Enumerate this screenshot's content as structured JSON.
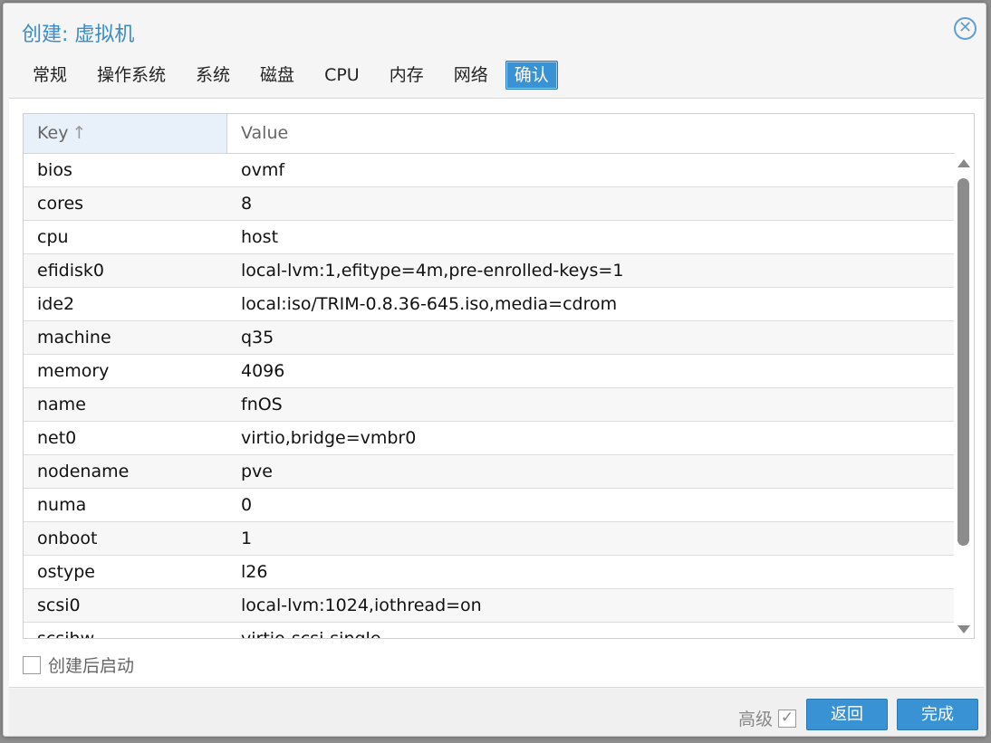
{
  "window": {
    "title": "创建: 虚拟机"
  },
  "tabs": [
    {
      "label": "常规"
    },
    {
      "label": "操作系统"
    },
    {
      "label": "系统"
    },
    {
      "label": "磁盘"
    },
    {
      "label": "CPU"
    },
    {
      "label": "内存"
    },
    {
      "label": "网络"
    },
    {
      "label": "确认",
      "active": true
    }
  ],
  "grid": {
    "columns": {
      "key": "Key",
      "value": "Value"
    },
    "sort_indicator": "↑",
    "rows": [
      {
        "key": "bios",
        "value": "ovmf"
      },
      {
        "key": "cores",
        "value": "8"
      },
      {
        "key": "cpu",
        "value": "host"
      },
      {
        "key": "efidisk0",
        "value": "local-lvm:1,efitype=4m,pre-enrolled-keys=1"
      },
      {
        "key": "ide2",
        "value": "local:iso/TRIM-0.8.36-645.iso,media=cdrom"
      },
      {
        "key": "machine",
        "value": "q35"
      },
      {
        "key": "memory",
        "value": "4096"
      },
      {
        "key": "name",
        "value": "fnOS"
      },
      {
        "key": "net0",
        "value": "virtio,bridge=vmbr0"
      },
      {
        "key": "nodename",
        "value": "pve"
      },
      {
        "key": "numa",
        "value": "0"
      },
      {
        "key": "onboot",
        "value": "1"
      },
      {
        "key": "ostype",
        "value": "l26"
      },
      {
        "key": "scsi0",
        "value": "local-lvm:1024,iothread=on"
      },
      {
        "key": "scsihw",
        "value": "virtio-scsi-single"
      }
    ]
  },
  "start_after_create": {
    "label": "创建后启动",
    "checked": false
  },
  "footer": {
    "advanced_label": "高级",
    "advanced_checked": true,
    "advanced_check_glyph": "✓",
    "back_label": "返回",
    "finish_label": "完成"
  },
  "colors": {
    "accent": "#3892d4",
    "title": "#3a8bc9"
  },
  "icons": {
    "close": "close-icon"
  },
  "close_glyph": "✕"
}
